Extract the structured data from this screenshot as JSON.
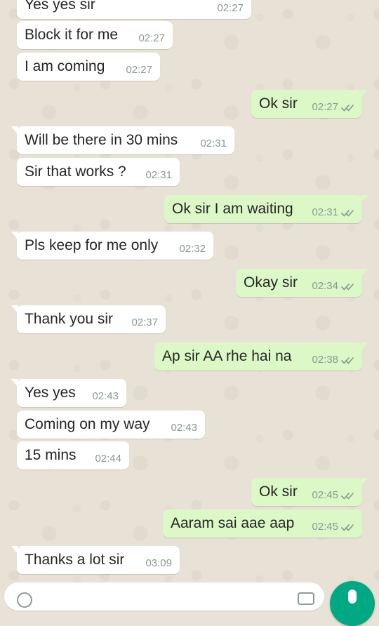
{
  "chat": {
    "messages": [
      {
        "direction": "in",
        "text": "Yes yes sir",
        "time": "02:27"
      },
      {
        "direction": "in",
        "text": "Block it for me",
        "time": "02:27"
      },
      {
        "direction": "in",
        "text": "I am coming",
        "time": "02:27"
      },
      {
        "direction": "out",
        "text": "Ok sir",
        "time": "02:27",
        "status": "read-ticks"
      },
      {
        "direction": "in",
        "text": "Will be there in 30 mins",
        "time": "02:31"
      },
      {
        "direction": "in",
        "text": "Sir that works ?",
        "time": "02:31"
      },
      {
        "direction": "out",
        "text": "Ok sir I am waiting",
        "time": "02:31",
        "status": "read-ticks"
      },
      {
        "direction": "in",
        "text": "Pls keep for me only",
        "time": "02:32"
      },
      {
        "direction": "out",
        "text": "Okay sir",
        "time": "02:34",
        "status": "read-ticks"
      },
      {
        "direction": "in",
        "text": "Thank you sir",
        "time": "02:37"
      },
      {
        "direction": "out",
        "text": "Ap sir AA rhe hai na",
        "time": "02:38",
        "status": "read-ticks"
      },
      {
        "direction": "in",
        "text": "Yes yes",
        "time": "02:43"
      },
      {
        "direction": "in",
        "text": "Coming on my way",
        "time": "02:43"
      },
      {
        "direction": "in",
        "text": "15 mins",
        "time": "02:44"
      },
      {
        "direction": "out",
        "text": "Ok sir",
        "time": "02:45",
        "status": "read-ticks"
      },
      {
        "direction": "out",
        "text": "Aaram sai aae aap",
        "time": "02:45",
        "status": "read-ticks"
      },
      {
        "direction": "in",
        "text": "Thanks a lot sir",
        "time": "03:09"
      }
    ]
  },
  "composer": {
    "emoji_icon": "emoji-icon",
    "camera_icon": "camera-icon",
    "send_icon": "mic-icon"
  },
  "colors": {
    "wallpaper": "#e8e1d6",
    "incoming_bubble": "#ffffff",
    "outgoing_bubble": "#dcf8c6",
    "time_text": "#8b9895",
    "fab": "#00a884"
  }
}
